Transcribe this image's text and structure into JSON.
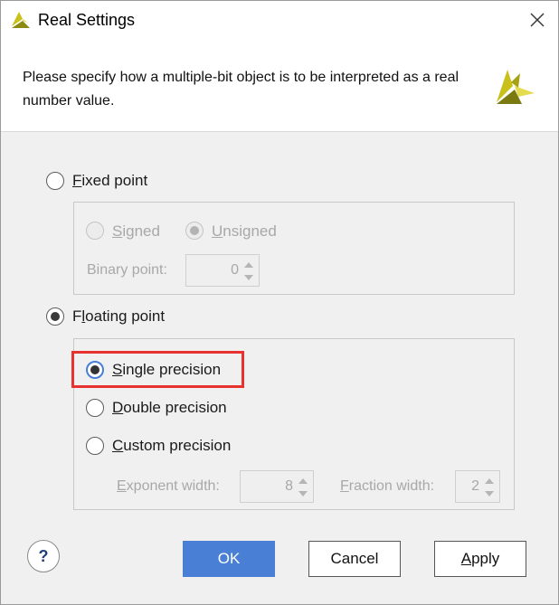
{
  "window": {
    "title": "Real Settings"
  },
  "header": {
    "description": "Please specify how a multiple-bit object is to be interpreted as a real number value."
  },
  "fixed_point": {
    "label_mnemonic": "F",
    "label_rest": "ixed point",
    "selected": false,
    "signed_mnemonic": "S",
    "signed_rest": "igned",
    "unsigned_mnemonic": "U",
    "unsigned_rest": "nsigned",
    "binary_point_label": "Binary point:",
    "binary_point_value": "0"
  },
  "floating_point": {
    "label_pre": "F",
    "label_mnemonic": "l",
    "label_rest": "oating point",
    "selected": true,
    "single_mnemonic": "S",
    "single_rest": "ingle precision",
    "double_mnemonic": "D",
    "double_rest": "ouble precision",
    "custom_mnemonic": "C",
    "custom_rest": "ustom precision",
    "exponent_mnemonic": "E",
    "exponent_rest": "xponent width:",
    "exponent_value": "8",
    "fraction_mnemonic": "F",
    "fraction_rest": "raction width:",
    "fraction_value": "2"
  },
  "buttons": {
    "help": "?",
    "ok": "OK",
    "cancel": "Cancel",
    "apply_mnemonic": "A",
    "apply_rest": "pply"
  },
  "colors": {
    "accent": "#4a7fd6",
    "highlight": "#e8322f",
    "logo": "#c8c200"
  },
  "icons": {
    "app": "xilinx-logo-icon",
    "close": "close-icon",
    "spin_up": "arrow-up-icon",
    "spin_down": "arrow-down-icon"
  }
}
